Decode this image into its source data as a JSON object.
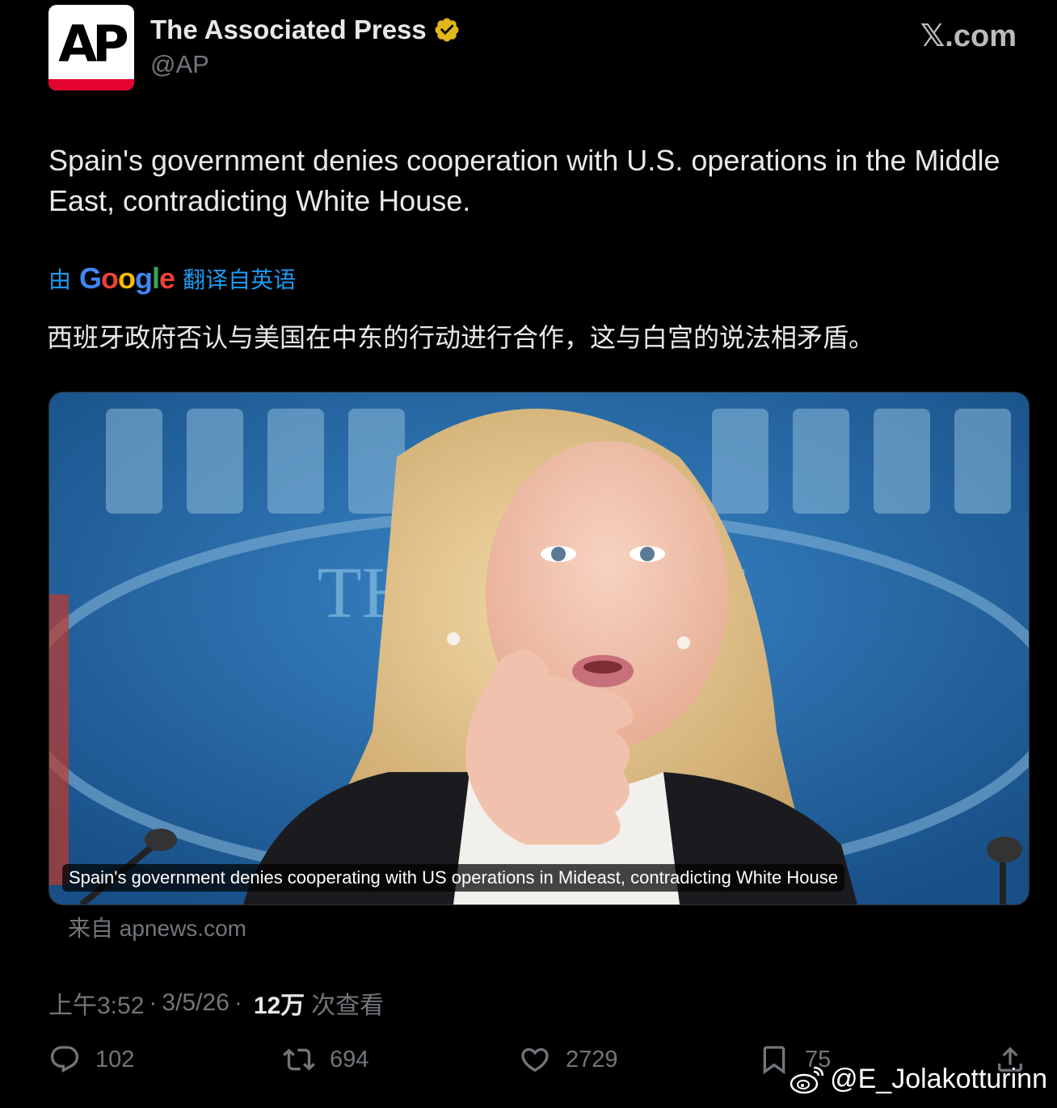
{
  "author": {
    "logo_text": "AP",
    "display_name": "The Associated Press",
    "handle": "@AP",
    "verified_icon": "verified-badge-gold"
  },
  "site_logo": "𝕏.com",
  "tweet": {
    "text": "Spain's government denies cooperation with U.S. operations in the Middle East, contradicting White House.",
    "translation": {
      "prefix": "由",
      "google_word": "Google",
      "suffix": "翻译自英语",
      "text": "西班牙政府否认与美国在中东的行动进行合作，这与白宫的说法相矛盾。"
    }
  },
  "card": {
    "caption": "Spain's government denies cooperating with US operations in Mideast, contradicting White House",
    "background_sign_text": "THE W    OUSE",
    "source": "来自 apnews.com"
  },
  "meta": {
    "time": "上午3:52",
    "date": "3/5/26",
    "views_count": "12万",
    "views_label": "次查看",
    "sep": "·"
  },
  "actions": {
    "reply_count": "102",
    "repost_count": "694",
    "like_count": "2729",
    "bookmark_count": "75"
  },
  "watermark": "@E_Jolakotturinn",
  "colors": {
    "background": "#000000",
    "text": "#e7e9ea",
    "muted": "#71767b",
    "link": "#1d9bf0",
    "ap_red": "#e4032e"
  }
}
